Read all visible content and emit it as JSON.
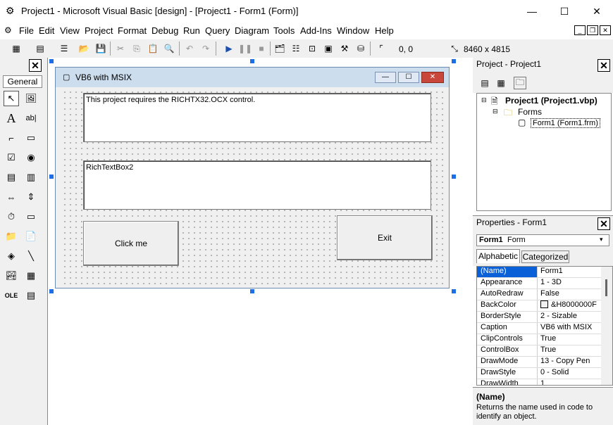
{
  "window": {
    "title": "Project1 - Microsoft Visual Basic [design] - [Project1 - Form1 (Form)]"
  },
  "menu": [
    "File",
    "Edit",
    "View",
    "Project",
    "Format",
    "Debug",
    "Run",
    "Query",
    "Diagram",
    "Tools",
    "Add-Ins",
    "Window",
    "Help"
  ],
  "toolbar": {
    "position": "0, 0",
    "size": "8460 x 4815"
  },
  "toolbox": {
    "tab": "General"
  },
  "form": {
    "title": "VB6 with MSIX",
    "rtb1_text": "This project requires the RICHTX32.OCX control.",
    "rtb2_text": "RichTextBox2",
    "button1": "Click me",
    "button2": "Exit"
  },
  "project_panel": {
    "title": "Project - Project1",
    "root": "Project1 (Project1.vbp)",
    "folder": "Forms",
    "item": "Form1 (Form1.frm)"
  },
  "properties_panel": {
    "title": "Properties - Form1",
    "object_name": "Form1",
    "object_type": "Form",
    "tabs": [
      "Alphabetic",
      "Categorized"
    ],
    "rows": [
      {
        "name": "(Name)",
        "value": "Form1"
      },
      {
        "name": "Appearance",
        "value": "1 - 3D"
      },
      {
        "name": "AutoRedraw",
        "value": "False"
      },
      {
        "name": "BackColor",
        "value": "&H8000000F"
      },
      {
        "name": "BorderStyle",
        "value": "2 - Sizable"
      },
      {
        "name": "Caption",
        "value": "VB6 with MSIX"
      },
      {
        "name": "ClipControls",
        "value": "True"
      },
      {
        "name": "ControlBox",
        "value": "True"
      },
      {
        "name": "DrawMode",
        "value": "13 - Copy Pen"
      },
      {
        "name": "DrawStyle",
        "value": "0 - Solid"
      },
      {
        "name": "DrawWidth",
        "value": "1"
      }
    ],
    "desc_title": "(Name)",
    "desc_text": "Returns the name used in code to identify an object."
  }
}
